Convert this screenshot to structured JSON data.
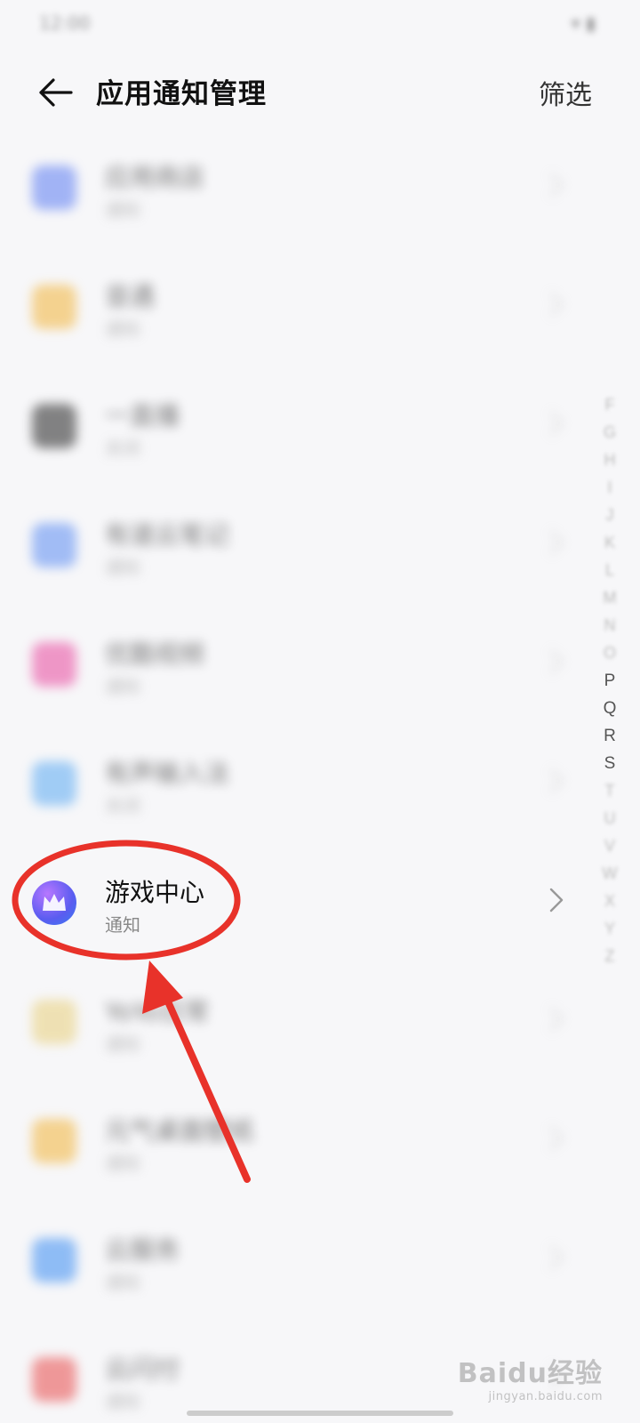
{
  "status_bar": {
    "time": "12:00",
    "right": ""
  },
  "header": {
    "title": "应用通知管理",
    "filter_label": "筛选"
  },
  "apps": [
    {
      "name": "应用商店",
      "sub": "通知",
      "color": "#5b7cf2",
      "blurred": true
    },
    {
      "name": "音遇",
      "sub": "通知",
      "color": "#f2b43a",
      "blurred": true
    },
    {
      "name": "一直播",
      "sub": "关闭",
      "color": "#222222",
      "blurred": true
    },
    {
      "name": "有道云笔记",
      "sub": "通知",
      "color": "#5b8cf2",
      "blurred": true
    },
    {
      "name": "优酷视频",
      "sub": "通知",
      "color": "#e8479e",
      "blurred": true
    },
    {
      "name": "有声输入法",
      "sub": "关闭",
      "color": "#5aa9f2",
      "blurred": true
    },
    {
      "name": "游戏中心",
      "sub": "通知",
      "color": "#7b5cf0",
      "blurred": false
    },
    {
      "name": "YoYo日常",
      "sub": "通知",
      "color": "#e8cf7a",
      "blurred": true
    },
    {
      "name": "元气桌面壁纸",
      "sub": "通知",
      "color": "#f2b43a",
      "blurred": true
    },
    {
      "name": "云服务",
      "sub": "通知",
      "color": "#3a8cf2",
      "blurred": true
    },
    {
      "name": "云闪付",
      "sub": "通知",
      "color": "#e84a4a",
      "blurred": true
    }
  ],
  "index_letters": [
    "F",
    "G",
    "H",
    "I",
    "J",
    "K",
    "L",
    "M",
    "N",
    "O",
    "P",
    "Q",
    "R",
    "S",
    "T",
    "U",
    "V",
    "W",
    "X",
    "Y",
    "Z"
  ],
  "index_sharp": [
    "P",
    "Q",
    "R",
    "S"
  ],
  "watermark": {
    "main": "Baidu经验",
    "sub": "jingyan.baidu.com"
  },
  "colors": {
    "annotation_red": "#e8322a",
    "background": "#f7f7f9"
  },
  "icons": {
    "back": "arrow-left-icon",
    "chevron": "chevron-right-icon",
    "game_center": "crown-icon"
  }
}
